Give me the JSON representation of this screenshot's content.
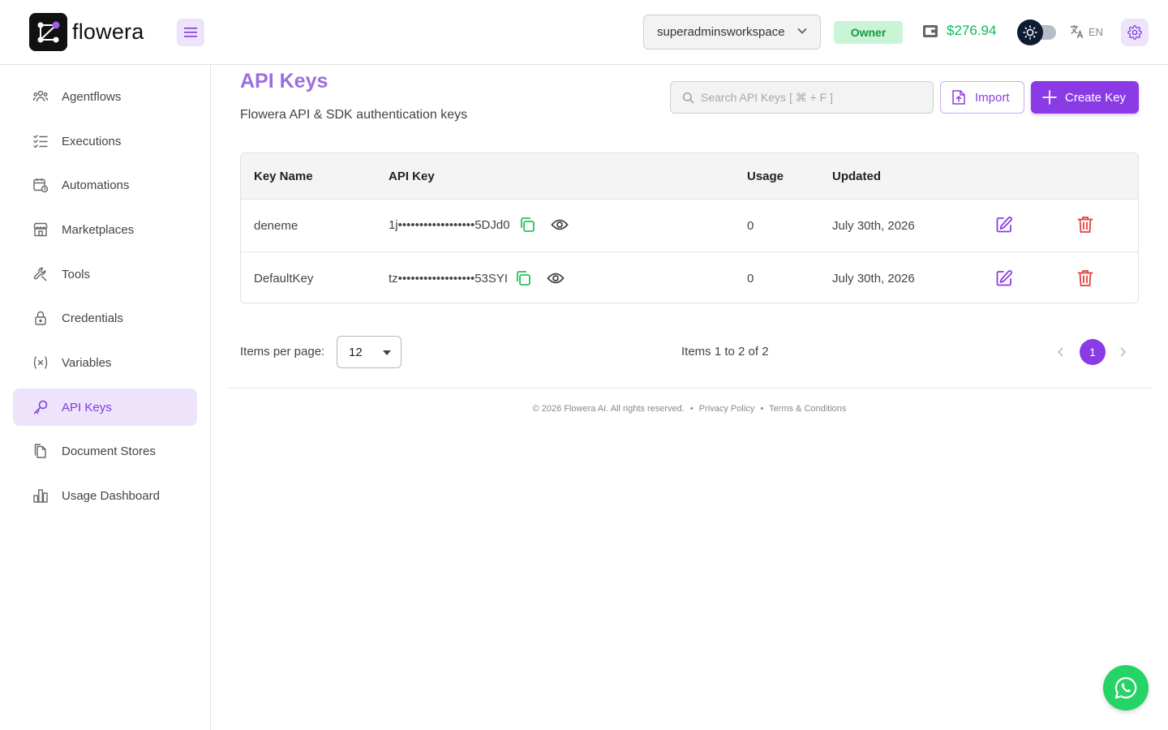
{
  "brand": {
    "name": "flowera"
  },
  "header": {
    "workspace": "superadminsworkspace",
    "role_badge": "Owner",
    "wallet_balance": "$276.94",
    "language": "EN",
    "colors": {
      "accent": "#8a3be6",
      "balance": "#12b955",
      "badge_bg": "#c9f4d6",
      "badge_text": "#129b41"
    }
  },
  "sidebar": {
    "items": [
      {
        "label": "Agentflows",
        "icon": "agents-icon"
      },
      {
        "label": "Executions",
        "icon": "list-check-icon"
      },
      {
        "label": "Automations",
        "icon": "calendar-clock-icon"
      },
      {
        "label": "Marketplaces",
        "icon": "store-icon"
      },
      {
        "label": "Tools",
        "icon": "wrench-icon"
      },
      {
        "label": "Credentials",
        "icon": "lock-icon"
      },
      {
        "label": "Variables",
        "icon": "variable-icon"
      },
      {
        "label": "API Keys",
        "icon": "key-icon",
        "active": true
      },
      {
        "label": "Document Stores",
        "icon": "documents-icon"
      },
      {
        "label": "Usage Dashboard",
        "icon": "bar-chart-icon"
      }
    ]
  },
  "main": {
    "title": "API Keys",
    "subtitle": "Flowera API & SDK authentication keys",
    "search_placeholder": "Search API Keys [ ⌘ + F ]",
    "import_label": "Import",
    "create_label": "Create Key",
    "table": {
      "columns": [
        "Key Name",
        "API Key",
        "Usage",
        "Updated"
      ],
      "rows": [
        {
          "name": "deneme",
          "key": "1j••••••••••••••••••5DJd0",
          "usage": "0",
          "updated": "July 30th, 2026"
        },
        {
          "name": "DefaultKey",
          "key": "tz••••••••••••••••••53SYI",
          "usage": "0",
          "updated": "July 30th, 2026"
        }
      ]
    },
    "pagination": {
      "per_page_label": "Items per page:",
      "per_page_value": "12",
      "items_info": "Items 1 to 2 of 2",
      "current_page": "1"
    }
  },
  "footer": {
    "copyright": "© 2026 Flowera AI. All rights reserved.",
    "separator": "•",
    "privacy": "Privacy Policy",
    "terms": "Terms & Conditions"
  }
}
